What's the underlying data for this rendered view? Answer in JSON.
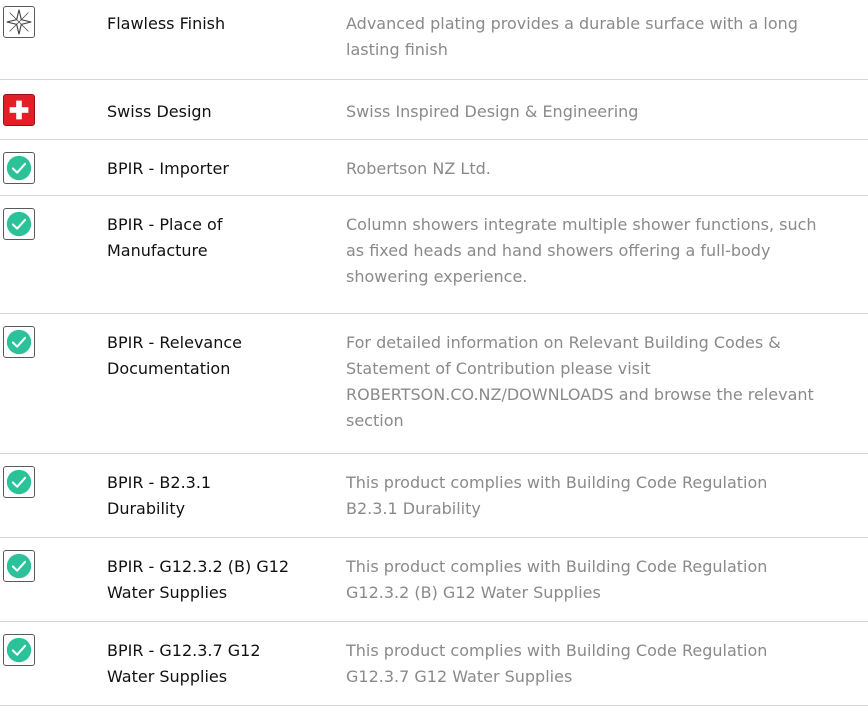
{
  "features": [
    {
      "icon": "sparkle-icon",
      "name": "Flawless Finish",
      "description": "Advanced plating provides a durable surface with a long lasting finish"
    },
    {
      "icon": "swiss-cross-icon",
      "name": "Swiss Design",
      "description": "Swiss Inspired Design & Engineering"
    },
    {
      "icon": "check-circle-icon",
      "name": "BPIR - Importer",
      "description": "Robertson NZ Ltd."
    },
    {
      "icon": "check-circle-icon",
      "name": "BPIR - Place of Manufacture",
      "description": "Column showers integrate multiple shower functions, such as fixed heads and hand showers offering a full-body showering experience."
    },
    {
      "icon": "check-circle-icon",
      "name": "BPIR - Relevance Documentation",
      "description": "For detailed information on Relevant Building Codes & Statement of Contribution please visit ROBERTSON.CO.NZ/DOWNLOADS and browse the relevant section"
    },
    {
      "icon": "check-circle-icon",
      "name": "BPIR - B2.3.1 Durability",
      "description": "This product complies with Building Code Regulation B2.3.1 Durability"
    },
    {
      "icon": "check-circle-icon",
      "name": "BPIR - G12.3.2 (B) G12 Water Supplies",
      "description": "This product complies with Building Code Regulation G12.3.2 (B) G12 Water Supplies"
    },
    {
      "icon": "check-circle-icon",
      "name": "BPIR - G12.3.7 G12 Water Supplies",
      "description": "This product complies with Building Code Regulation G12.3.7 G12 Water Supplies"
    }
  ],
  "colors": {
    "check": "#2bc29a",
    "swiss_red": "#e41e26",
    "label_text": "#111111",
    "description_text": "#8a8a8a",
    "divider": "#d6d6d6"
  }
}
